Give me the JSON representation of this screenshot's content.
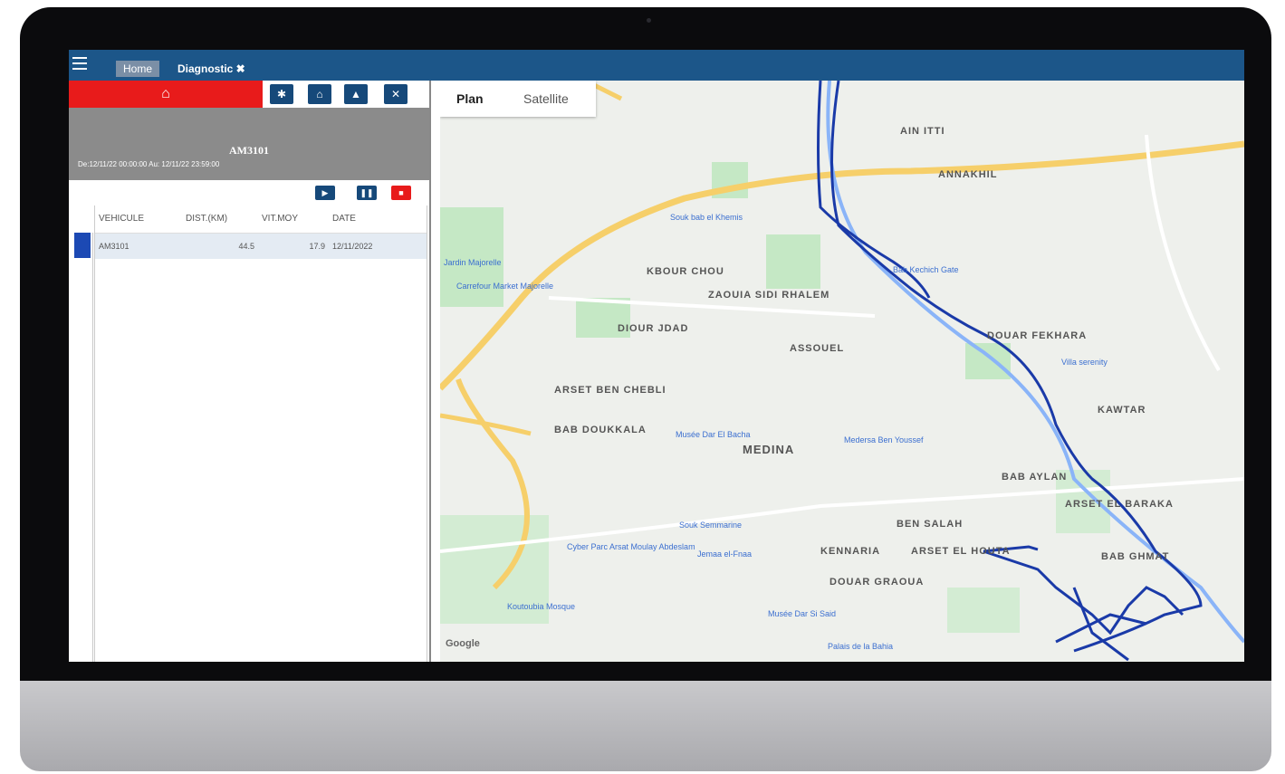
{
  "topbar": {
    "tab_home": "Home",
    "tab_diagnostic": "Diagnostic ✖"
  },
  "panel": {
    "vehicle_id": "AM3101",
    "date_range": "De:12/11/22 00:00:00 Au: 12/11/22 23:59:00",
    "columns": [
      "VEHICULE",
      "DIST.(KM)",
      "VIT.MOY",
      "DATE"
    ],
    "rows": [
      {
        "vehicle": "AM3101",
        "distance": "44.5",
        "speed": "17.9",
        "date": "12/11/2022"
      }
    ]
  },
  "map": {
    "tab_plan": "Plan",
    "tab_satellite": "Satellite",
    "labels": [
      "ANNAKHIL",
      "AIN ITTI",
      "KBOUR CHOU",
      "ZAOUIA SIDI RHALEM",
      "DIOUR JDAD",
      "ASSOUEL",
      "ARSET BEN CHEBLI",
      "BAB DOUKKALA",
      "MEDINA",
      "BAB AYLAN",
      "ARSET EL BARAKA",
      "BEN SALAH",
      "KENNARIA",
      "ARSET EL HOUTA",
      "DOUAR GRAOUA",
      "DOUAR FEKHARA",
      "KAWTAR",
      "BAB GHMAT"
    ],
    "places": [
      "Souk bab el Khemis",
      "Bab Kechich Gate",
      "Villa serenity",
      "Musée Dar El Bacha",
      "Medersa Ben Youssef",
      "Souk Semmarine",
      "Jemaa el-Fnaa",
      "Musée Dar Si Said",
      "Palais de la Bahia",
      "Koutoubia Mosque",
      "Carrefour Market Majorelle",
      "Jardin Majorelle",
      "Cyber Parc Arsat Moulay Abdeslam",
      "Google"
    ]
  },
  "colors": {
    "topbar": "#1c5689",
    "home_red": "#e81b1b",
    "route": "#1a3aa8"
  }
}
